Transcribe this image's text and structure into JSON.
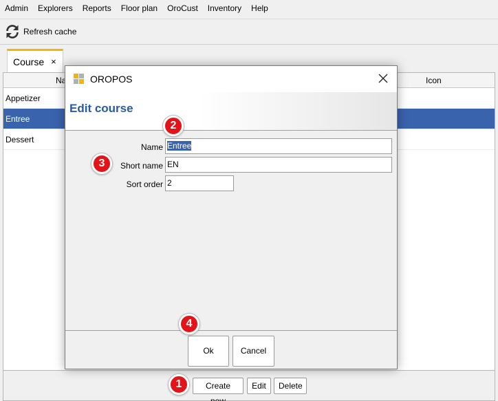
{
  "menu": [
    "Admin",
    "Explorers",
    "Reports",
    "Floor plan",
    "OroCust",
    "Inventory",
    "Help"
  ],
  "toolbar": {
    "refresh_label": "Refresh cache"
  },
  "tab": {
    "label": "Course",
    "close": "×"
  },
  "table": {
    "headers": [
      "Na",
      "Icon"
    ],
    "rows": [
      "Appetizer",
      "Entree",
      "Dessert"
    ],
    "selected_index": 1
  },
  "buttons": {
    "create_new": "Create new",
    "edit": "Edit",
    "delete": "Delete"
  },
  "badges": [
    "1",
    "2",
    "3",
    "4"
  ],
  "dialog": {
    "window_title": "OROPOS",
    "heading": "Edit course",
    "fields": {
      "name_label": "Name",
      "name_value": "Entree",
      "short_name_label": "Short name",
      "short_name_value": "EN",
      "sort_order_label": "Sort order",
      "sort_order_value": "2"
    },
    "ok": "Ok",
    "cancel": "Cancel"
  },
  "colors": {
    "selection": "#3a63ad",
    "heading": "#2c5aa0",
    "badge": "#e2141a",
    "tab_accent": "#f4b400"
  }
}
